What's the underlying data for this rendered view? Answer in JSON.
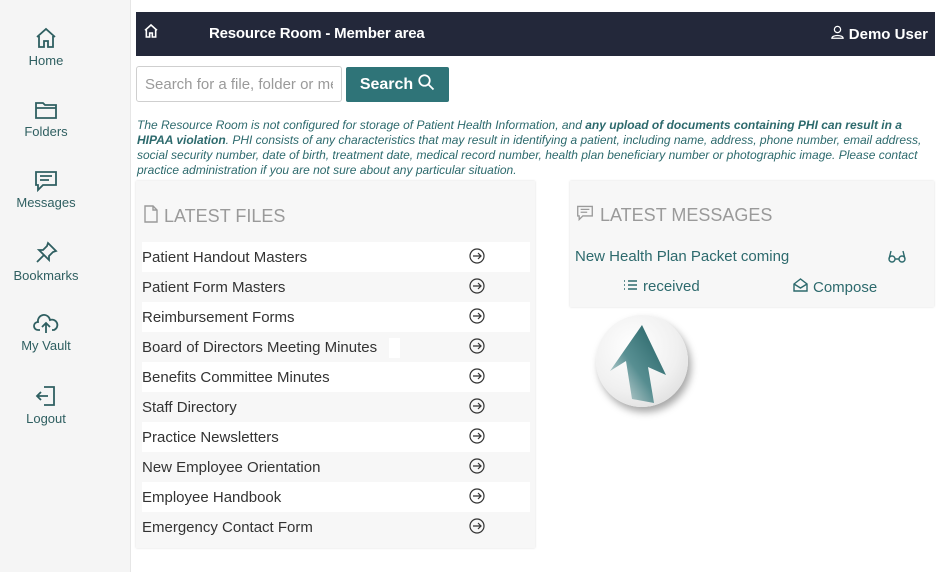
{
  "sidebar": {
    "items": [
      {
        "label": "Home",
        "icon": "home-icon"
      },
      {
        "label": "Folders",
        "icon": "folder-icon"
      },
      {
        "label": "Messages",
        "icon": "message-icon"
      },
      {
        "label": "Bookmarks",
        "icon": "pin-icon"
      },
      {
        "label": "My Vault",
        "icon": "cloud-upload-icon"
      },
      {
        "label": "Logout",
        "icon": "logout-icon"
      }
    ]
  },
  "header": {
    "title": "Resource Room - Member area",
    "user": "Demo User"
  },
  "search": {
    "placeholder": "Search for a file, folder or message",
    "button_label": "Search"
  },
  "notice": {
    "part1": "The Resource Room is not configured for storage of Patient Health Information, and ",
    "bold": "any upload of documents containing PHI can result in a HIPAA violation",
    "part2": ". PHI consists of any characteristics that may result in identifying a patient, including name, address, phone number, email address, social security number, date of birth, treatment date, medical record number, health plan beneficiary number or photographic image. Please contact practice administration if you are not sure about any particular situation."
  },
  "files": {
    "heading": "LATEST FILES",
    "items": [
      "Patient Handout Masters",
      "Patient Form Masters",
      "Reimbursement Forms",
      "Board of Directors Meeting Minutes",
      "Benefits Committee Minutes",
      "Staff Directory",
      "Practice Newsletters",
      "New Employee Orientation",
      "Employee Handbook",
      "Emergency Contact Form"
    ]
  },
  "messages": {
    "heading": "LATEST MESSAGES",
    "latest": "New Health Plan Packet coming",
    "received_label": "received",
    "compose_label": "Compose"
  },
  "colors": {
    "accent": "#2f7478",
    "topbar": "#23283a",
    "text_teal": "#2d6a6d"
  }
}
